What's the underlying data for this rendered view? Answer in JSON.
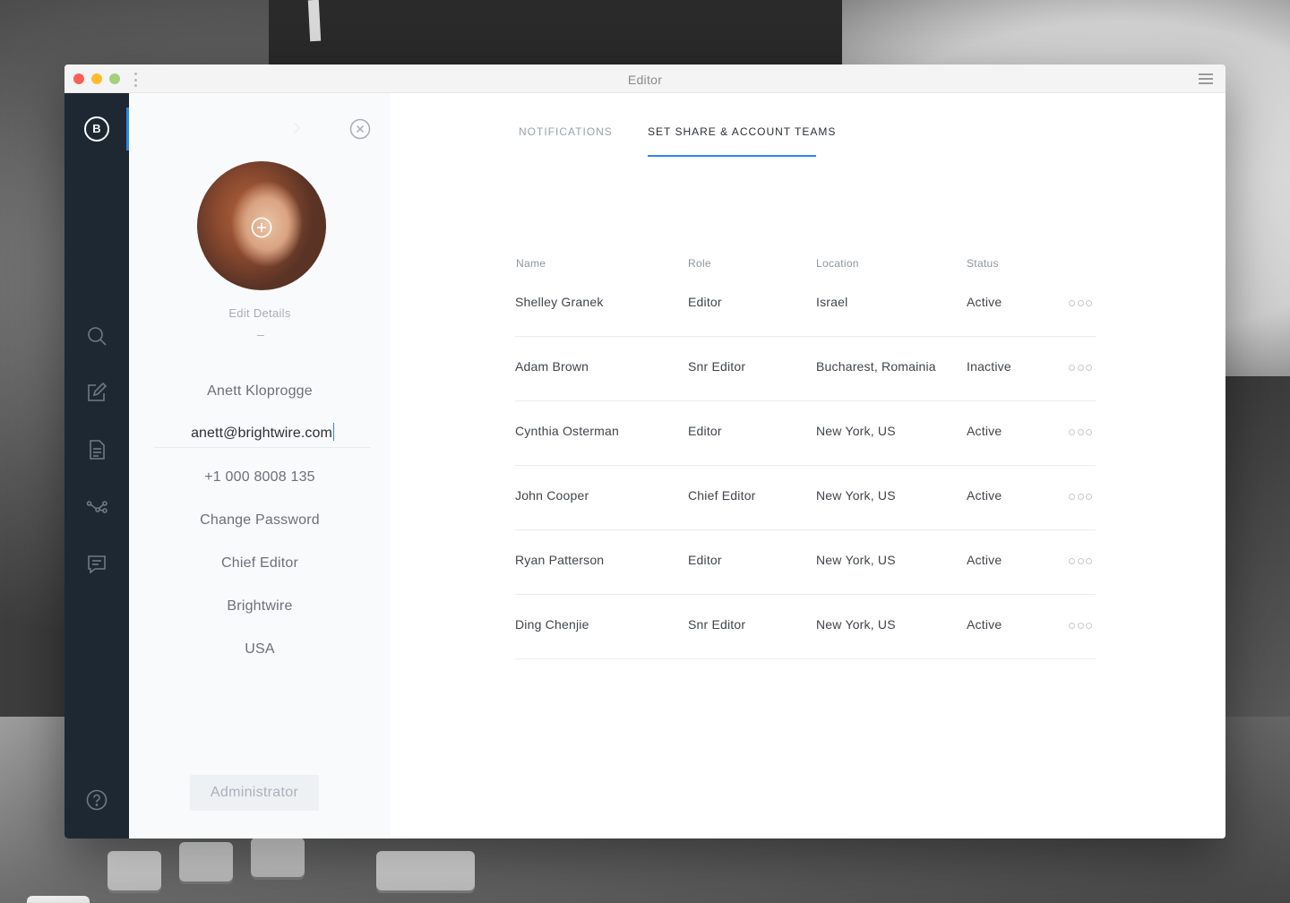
{
  "window": {
    "title": "Editor"
  },
  "sidebar": {
    "logo_letter": "B",
    "icons": [
      "search-icon",
      "edit-icon",
      "document-icon",
      "share-icon",
      "chat-icon",
      "help-icon"
    ]
  },
  "profile": {
    "edit_details_label": "Edit Details",
    "name": "Anett Kloprogge",
    "email": "anett@brightwire.com",
    "phone": "+1 000 8008 135",
    "change_password_label": "Change Password",
    "role": "Chief Editor",
    "company": "Brightwire",
    "country": "USA",
    "admin_button_label": "Administrator"
  },
  "tabs": [
    {
      "label": "NOTIFICATIONS",
      "active": false
    },
    {
      "label": "SET SHARE & ACCOUNT TEAMS",
      "active": true
    }
  ],
  "table": {
    "columns": [
      "Name",
      "Role",
      "Location",
      "Status"
    ],
    "rows": [
      {
        "name": "Shelley Granek",
        "role": "Editor",
        "location": "Israel",
        "status": "Active"
      },
      {
        "name": "Adam Brown",
        "role": "Snr Editor",
        "location": "Bucharest, Romainia",
        "status": "Inactive"
      },
      {
        "name": "Cynthia Osterman",
        "role": "Editor",
        "location": "New York, US",
        "status": "Active"
      },
      {
        "name": "John Cooper",
        "role": "Chief Editor",
        "location": "New York, US",
        "status": "Active"
      },
      {
        "name": "Ryan Patterson",
        "role": "Editor",
        "location": "New York, US",
        "status": "Active"
      },
      {
        "name": "Ding Chenjie",
        "role": "Snr Editor",
        "location": "New York, US",
        "status": "Active"
      }
    ]
  },
  "colors": {
    "accent": "#2f87e6",
    "sidebar_bg": "#1e2832",
    "profile_bg": "#f9fafb"
  }
}
